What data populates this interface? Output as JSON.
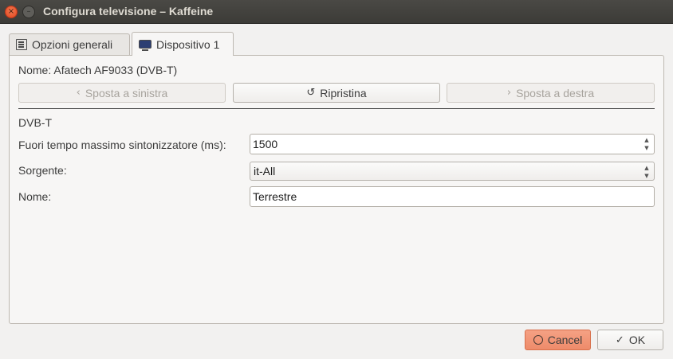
{
  "window": {
    "title": "Configura televisione – Kaffeine",
    "close_glyph": "×",
    "minimize_glyph": "–"
  },
  "tabs": [
    {
      "label": "Opzioni generali",
      "icon": "list-icon"
    },
    {
      "label": "Dispositivo 1",
      "icon": "tv-icon",
      "active": true
    }
  ],
  "device": {
    "name_label": "Nome: Afatech AF9033 (DVB-T)",
    "move_left": {
      "glyph": "‹",
      "label": "Sposta a sinistra",
      "enabled": false
    },
    "reset": {
      "glyph": "↺",
      "label": "Ripristina",
      "enabled": true
    },
    "move_right": {
      "glyph": "›",
      "label": "Sposta a destra",
      "enabled": false
    },
    "section": "DVB-T",
    "timeout": {
      "label": "Fuori tempo massimo sintonizzatore (ms):",
      "value": "1500"
    },
    "source": {
      "label": "Sorgente:",
      "value": "it-All"
    },
    "name": {
      "label": "Nome:",
      "value": "Terrestre"
    }
  },
  "dialog": {
    "cancel": {
      "glyph": "⃠",
      "label": "Cancel"
    },
    "ok": {
      "glyph": "✓",
      "label": "OK"
    }
  },
  "colors": {
    "titlebar": "#3c3b37",
    "cancel_accent": "#f09a7b",
    "close_button": "#e9542a"
  }
}
